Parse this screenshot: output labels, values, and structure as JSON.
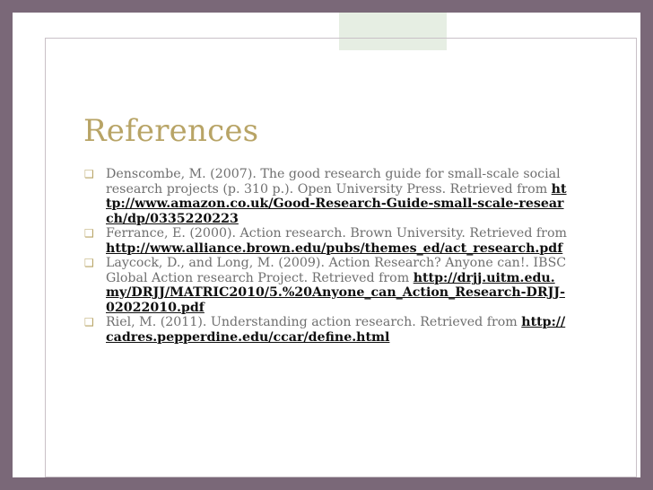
{
  "slide": {
    "title": "References",
    "references": [
      {
        "text": "Denscombe, M. (2007). The good research guide for small-scale social research projects (p. 310 p.). Open University Press. Retrieved from ",
        "link": "http://www.amazon.co.uk/Good-Research-Guide-small-scale-research/dp/0335220223"
      },
      {
        "text": "Ferrance, E. (2000). Action research. Brown University. Retrieved from ",
        "link": "http://www.alliance.brown.edu/pubs/themes_ed/act_research.pdf"
      },
      {
        "text": "Laycock, D., and Long, M. (2009). Action Research? Anyone can!. IBSC Global Action research Project. Retrieved from ",
        "link": "http://drjj.uitm.edu.my/DRJJ/MATRIC2010/5.%20Anyone_can_Action_Research-DRJJ-02022010.pdf"
      },
      {
        "text": "Riel, M. (2011). Understanding action research. Retrieved from ",
        "link": "http://cadres.pepperdine.edu/ccar/define.html"
      }
    ]
  },
  "colors": {
    "background": "#7a6878",
    "title": "#b8a466",
    "bullet": "#b8a466",
    "body_text": "#6f6f6f",
    "link": "#0f0f0f"
  },
  "icons": {
    "bullet": "square-bullet-icon"
  }
}
